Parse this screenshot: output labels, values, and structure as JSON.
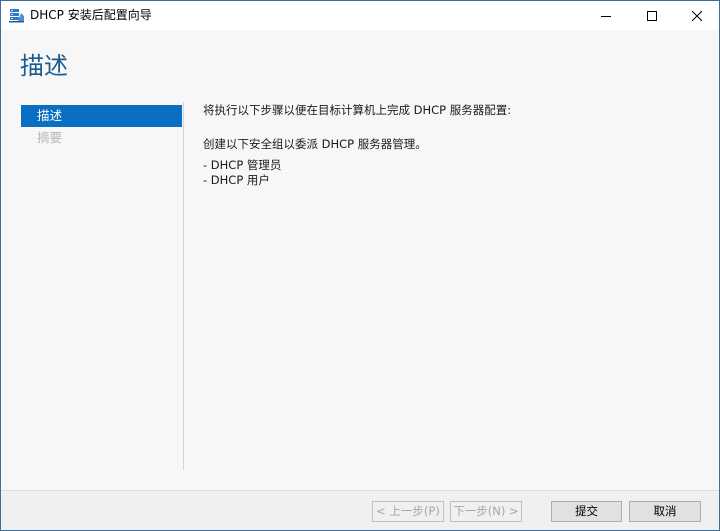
{
  "window": {
    "title": "DHCP 安装后配置向导",
    "icon": "server-wizard-icon",
    "controls": {
      "minimize": "minimize-icon",
      "maximize": "maximize-icon",
      "close": "close-icon"
    }
  },
  "page": {
    "heading": "描述"
  },
  "nav": {
    "items": [
      {
        "label": "描述",
        "state": "active"
      },
      {
        "label": "摘要",
        "state": "disabled"
      }
    ]
  },
  "main": {
    "intro": "将执行以下步骤以便在目标计算机上完成 DHCP 服务器配置:",
    "group_intro": "创建以下安全组以委派 DHCP 服务器管理。",
    "groups": [
      "- DHCP 管理员",
      "- DHCP 用户"
    ]
  },
  "footer": {
    "prev_label": "< 上一步(P)",
    "next_label": "下一步(N) >",
    "commit_label": "提交",
    "cancel_label": "取消"
  },
  "colors": {
    "accent": "#0a6fc2",
    "heading": "#1c5a8c",
    "window_border": "#3c6e9e",
    "disabled_text": "#b8b8b8"
  }
}
